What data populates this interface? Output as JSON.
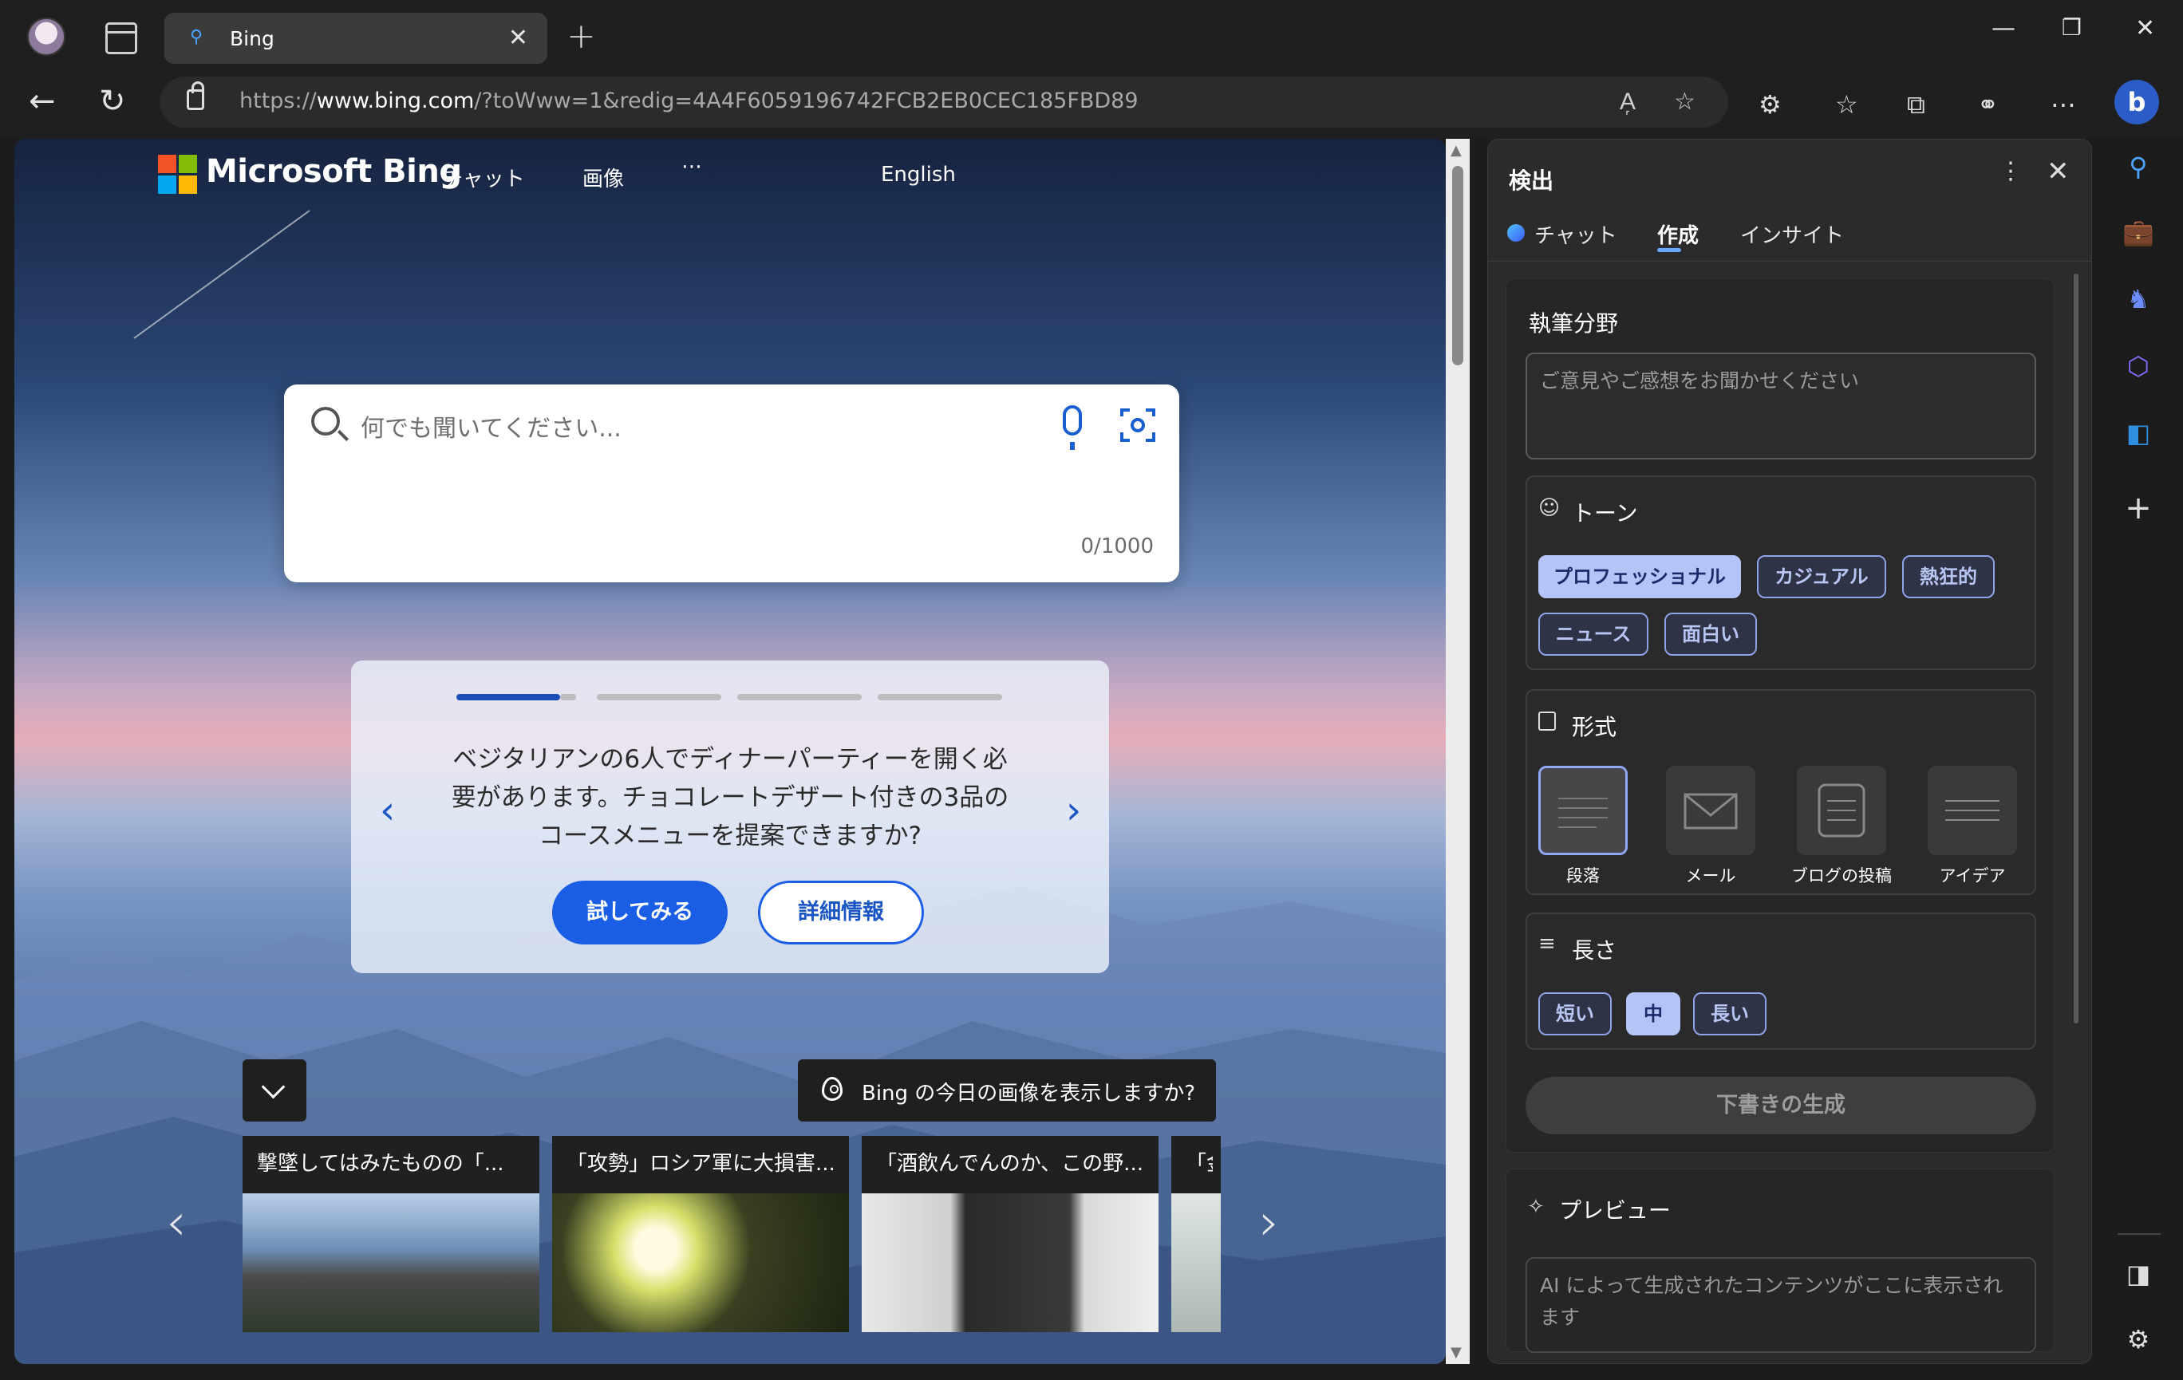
{
  "browser": {
    "tab": {
      "title": "Bing",
      "favicon": "search-icon"
    },
    "new_tab_icon": "plus-icon",
    "url": {
      "prefix": "https://",
      "domain": "www.bing.com",
      "path": "/?toWww=1&redig=4A4F6059196742FCB2EB0CEC185FBD89"
    },
    "window_controls": [
      "minimize-icon",
      "restore-icon",
      "close-icon"
    ]
  },
  "bing": {
    "brand": "Microsoft Bing",
    "nav": {
      "chat": "チャット",
      "images": "画像",
      "more": "⋯",
      "lang": "English"
    },
    "search": {
      "placeholder": "何でも聞いてください...",
      "counter": "0/1000"
    },
    "carousel": {
      "text": "ベジタリアンの6人でディナーパーティーを開く必要があります。チョコレートデザート付きの3品のコースメニューを提案できますか?",
      "active_index": 0,
      "total": 4,
      "try_label": "試してみる",
      "more_label": "詳細情報"
    },
    "bg_image_prompt": "Bing の今日の画像を表示しますか?",
    "news": [
      {
        "title": "撃墜してはみたものの「..."
      },
      {
        "title": "「攻勢」ロシア軍に大損害..."
      },
      {
        "title": "「酒飲んでんのか、この野..."
      },
      {
        "title": "「金"
      }
    ]
  },
  "panel": {
    "title": "検出",
    "tabs": {
      "chat": "チャット",
      "compose": "作成",
      "insight": "インサイト"
    },
    "active_tab": "compose",
    "compose": {
      "topic_label": "執筆分野",
      "topic_placeholder": "ご意見やご感想をお聞かせください",
      "tone_label": "トーン",
      "tones": [
        "プロフェッショナル",
        "カジュアル",
        "熱狂的",
        "ニュース",
        "面白い"
      ],
      "tone_selected": "プロフェッショナル",
      "format_label": "形式",
      "formats": [
        "段落",
        "メール",
        "ブログの投稿",
        "アイデア"
      ],
      "format_selected": "段落",
      "length_label": "長さ",
      "lengths": [
        "短い",
        "中",
        "長い"
      ],
      "length_selected": "中",
      "generate_label": "下書きの生成"
    },
    "preview": {
      "label": "プレビュー",
      "placeholder": "AI によって生成されたコンテンツがここに表示されます"
    }
  },
  "sidebar_icons": [
    "search-icon",
    "shopping-icon",
    "games-icon",
    "office-icon",
    "outlook-icon",
    "add-icon",
    "sidebar-toggle-icon",
    "settings-icon"
  ]
}
